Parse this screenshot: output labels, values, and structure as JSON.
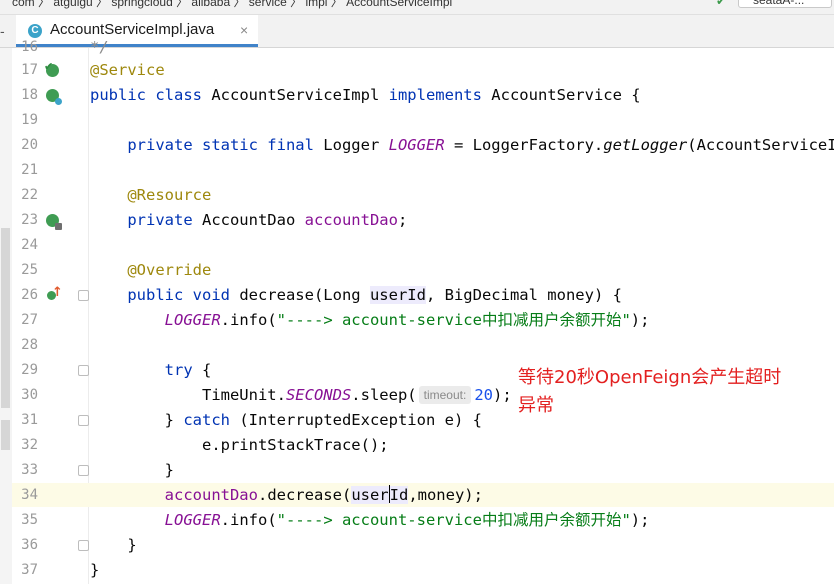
{
  "breadcrumb": {
    "text": "com  〉 atguigu  〉 springcloud  〉 alibaba  〉 service  〉 impl  〉 AccountServiceImpl",
    "right_button_label": "seataA-..."
  },
  "editor": {
    "tab": {
      "icon_letter": "C",
      "label": "AccountServiceImpl.java",
      "close": "×"
    },
    "partial_top_line": {
      "number": "16",
      "text": "*/"
    },
    "lines": [
      {
        "number": "17",
        "parts": [
          {
            "t": "@Service",
            "c": "an"
          }
        ]
      },
      {
        "number": "18",
        "parts": [
          {
            "t": "public class ",
            "c": "kw"
          },
          {
            "t": "AccountServiceImpl ",
            "c": ""
          },
          {
            "t": "implements ",
            "c": "kw"
          },
          {
            "t": "AccountService {",
            "c": ""
          }
        ]
      },
      {
        "number": "19",
        "parts": []
      },
      {
        "number": "20",
        "parts": [
          {
            "t": "    private static final ",
            "c": "kw"
          },
          {
            "t": "Logger ",
            "c": ""
          },
          {
            "t": "LOGGER",
            "c": "itf"
          },
          {
            "t": " = LoggerFactory.",
            "c": ""
          },
          {
            "t": "getLogger",
            "c": "it"
          },
          {
            "t": "(AccountServiceImpl.",
            "c": ""
          }
        ]
      },
      {
        "number": "21",
        "parts": []
      },
      {
        "number": "22",
        "parts": [
          {
            "t": "    @Resource",
            "c": "an"
          }
        ]
      },
      {
        "number": "23",
        "parts": [
          {
            "t": "    private ",
            "c": "kw"
          },
          {
            "t": "AccountDao ",
            "c": ""
          },
          {
            "t": "accountDao",
            "c": "fld"
          },
          {
            "t": ";",
            "c": ""
          }
        ]
      },
      {
        "number": "24",
        "parts": []
      },
      {
        "number": "25",
        "parts": [
          {
            "t": "    @Override",
            "c": "an"
          }
        ]
      },
      {
        "number": "26",
        "parts": [
          {
            "t": "    public void ",
            "c": "kw"
          },
          {
            "t": "decrease(Long ",
            "c": ""
          },
          {
            "t": "userId",
            "c": "param-hl"
          },
          {
            "t": ", BigDecimal money) {",
            "c": ""
          }
        ]
      },
      {
        "number": "27",
        "parts": [
          {
            "t": "        LOGGER",
            "c": "itf"
          },
          {
            "t": ".info(",
            "c": ""
          },
          {
            "t": "\"----> account-service中扣减用户余额开始\"",
            "c": "st"
          },
          {
            "t": ");",
            "c": ""
          }
        ]
      },
      {
        "number": "28",
        "parts": []
      },
      {
        "number": "29",
        "parts": [
          {
            "t": "        try ",
            "c": "kw"
          },
          {
            "t": "{",
            "c": ""
          }
        ]
      },
      {
        "number": "30",
        "parts": [
          {
            "t": "            TimeUnit.",
            "c": ""
          },
          {
            "t": "SECONDS",
            "c": "itf"
          },
          {
            "t": ".sleep(",
            "c": ""
          },
          {
            "t": "timeout:",
            "c": "hint"
          },
          {
            "t": "20",
            "c": "num"
          },
          {
            "t": ");",
            "c": ""
          }
        ]
      },
      {
        "number": "31",
        "parts": [
          {
            "t": "        } ",
            "c": ""
          },
          {
            "t": "catch ",
            "c": "kw"
          },
          {
            "t": "(InterruptedException e) {",
            "c": ""
          }
        ]
      },
      {
        "number": "32",
        "parts": [
          {
            "t": "            e.printStackTrace();",
            "c": ""
          }
        ]
      },
      {
        "number": "33",
        "parts": [
          {
            "t": "        }",
            "c": ""
          }
        ]
      },
      {
        "number": "34",
        "parts": [
          {
            "t": "        accountDao",
            "c": "fld"
          },
          {
            "t": ".decrease(",
            "c": ""
          },
          {
            "t": "user",
            "c": "param-hl"
          },
          {
            "t": "",
            "c": "caret"
          },
          {
            "t": "Id",
            "c": "param-hl"
          },
          {
            "t": ",money);",
            "c": ""
          }
        ]
      },
      {
        "number": "35",
        "parts": [
          {
            "t": "        LOGGER",
            "c": "itf"
          },
          {
            "t": ".info(",
            "c": ""
          },
          {
            "t": "\"----> account-service中扣减用户余额开始\"",
            "c": "st"
          },
          {
            "t": ");",
            "c": ""
          }
        ]
      },
      {
        "number": "36",
        "parts": [
          {
            "t": "    }",
            "c": ""
          }
        ]
      },
      {
        "number": "37",
        "parts": [
          {
            "t": "}",
            "c": ""
          }
        ]
      }
    ]
  },
  "annotation": {
    "line1": "等待20秒OpenFeign会产生超时",
    "line2": "异常"
  }
}
